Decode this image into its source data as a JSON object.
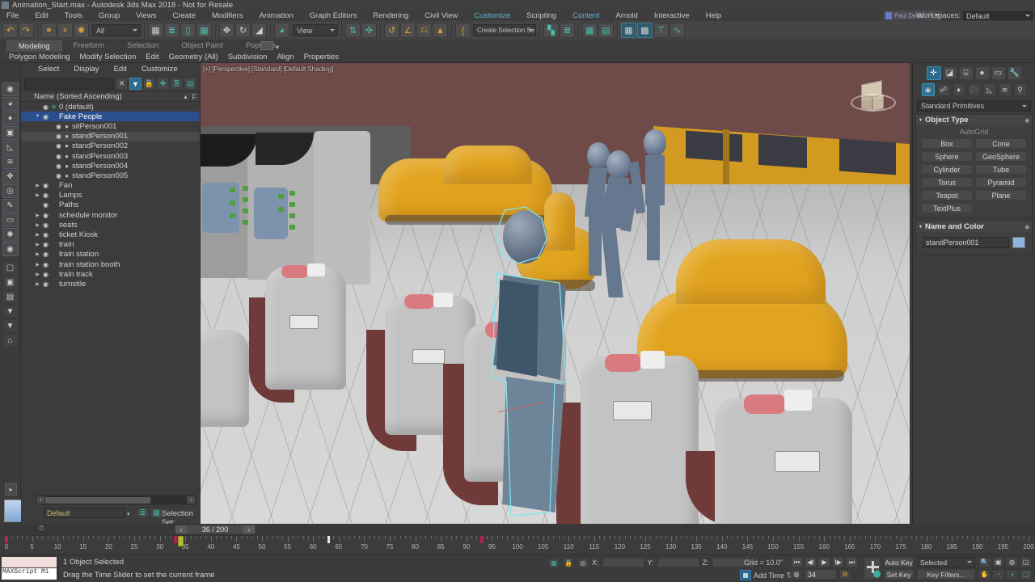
{
  "window": {
    "title": "Animation_Start.max - Autodesk 3ds Max 2018 - Not for Resale",
    "app_icon": "max-logo-icon"
  },
  "menu": {
    "items": [
      "File",
      "Edit",
      "Tools",
      "Group",
      "Views",
      "Create",
      "Modifiers",
      "Animation",
      "Graph Editors",
      "Rendering",
      "Civil View",
      "Customize",
      "Scripting",
      "Content",
      "Arnold",
      "Interactive",
      "Help"
    ]
  },
  "workspaces": {
    "label": "Workspaces:",
    "value": "Default"
  },
  "user": {
    "name": "Paul Dean"
  },
  "main_toolbar": {
    "selection_filter": "All",
    "reference_coord": "View",
    "named_selection_set": "Create Selection Se",
    "buttons": [
      {
        "name": "undo-button",
        "glyph": "↶"
      },
      {
        "name": "redo-button",
        "glyph": "↷"
      },
      {
        "name": "select-link-button",
        "glyph": "⛓"
      },
      {
        "name": "unlink-button",
        "glyph": "⛓"
      },
      {
        "name": "bind-space-warp-button",
        "glyph": "✳"
      },
      {
        "name": "select-object-button",
        "glyph": "▣"
      },
      {
        "name": "select-by-name-button",
        "glyph": "≣"
      },
      {
        "name": "rectangular-select-region-button",
        "glyph": "▭"
      },
      {
        "name": "window-crossing-button",
        "glyph": "▨"
      },
      {
        "name": "select-and-move-button",
        "glyph": "✥"
      },
      {
        "name": "select-and-rotate-button",
        "glyph": "↻"
      },
      {
        "name": "select-and-scale-button",
        "glyph": "◲"
      },
      {
        "name": "use-center-flyout-button",
        "glyph": "◕"
      },
      {
        "name": "mirror-button",
        "glyph": "⇹"
      },
      {
        "name": "align-button",
        "glyph": "⊹"
      },
      {
        "name": "layer-explorer-button",
        "glyph": "▤"
      },
      {
        "name": "curve-editor-button",
        "glyph": "〜"
      },
      {
        "name": "schematic-view-button",
        "glyph": "◔"
      },
      {
        "name": "percent-snap-button",
        "glyph": "%"
      },
      {
        "name": "angle-snap-button",
        "glyph": "∠"
      },
      {
        "name": "spinner-snap-button",
        "glyph": "⌁"
      },
      {
        "name": "material-editor-button",
        "glyph": "◍"
      },
      {
        "name": "render-setup-button",
        "glyph": "▤"
      },
      {
        "name": "render-frame-window-button",
        "glyph": "▦"
      },
      {
        "name": "render-production-button",
        "glyph": "▩"
      },
      {
        "name": "render-iterative-button",
        "glyph": "▨"
      },
      {
        "name": "active-shade-button",
        "glyph": "⊤"
      },
      {
        "name": "project-folder-button",
        "glyph": "⊷"
      }
    ]
  },
  "ribbon": {
    "tabs": [
      "Modeling",
      "Freeform",
      "Selection",
      "Object Paint",
      "Populate"
    ],
    "active_tab": "Modeling",
    "subtabs": [
      "Polygon Modeling",
      "Modify Selection",
      "Edit",
      "Geometry (All)",
      "Subdivision",
      "Align",
      "Properties"
    ]
  },
  "left_toolbar": {
    "buttons": [
      {
        "name": "select-object-tool",
        "glyph": "◉"
      },
      {
        "name": "select-similar-tool",
        "glyph": "◕"
      },
      {
        "name": "select-light-tool",
        "glyph": "♦"
      },
      {
        "name": "select-camera-tool",
        "glyph": "▣"
      },
      {
        "name": "select-helper-tool",
        "glyph": "◺"
      },
      {
        "name": "select-spline-tool",
        "glyph": "≋"
      },
      {
        "name": "select-shape-tool",
        "glyph": "✥"
      },
      {
        "name": "select-group-tool",
        "glyph": "◎"
      },
      {
        "name": "select-bone-tool",
        "glyph": "✎"
      },
      {
        "name": "select-box-tool",
        "glyph": "▭"
      },
      {
        "name": "select-particle-tool",
        "glyph": "✺"
      },
      {
        "name": "select-vis-tool",
        "glyph": "◉"
      },
      {
        "name": "layer-tool-1",
        "glyph": "▢"
      },
      {
        "name": "layer-tool-2",
        "glyph": "▣"
      },
      {
        "name": "layer-tool-3",
        "glyph": "▤"
      },
      {
        "name": "filter-tool-1",
        "glyph": "▼"
      },
      {
        "name": "filter-tool-2",
        "glyph": "▼"
      },
      {
        "name": "display-tool",
        "glyph": "⌂"
      }
    ]
  },
  "explorer": {
    "menu": [
      "Select",
      "Display",
      "Edit",
      "Customize"
    ],
    "search_value": "",
    "toolbar_buttons": [
      {
        "name": "clear-search-button",
        "glyph": "✕"
      },
      {
        "name": "filter-button",
        "glyph": "▼"
      },
      {
        "name": "lock-button",
        "glyph": "🔒"
      },
      {
        "name": "add-object-button",
        "glyph": "✛"
      },
      {
        "name": "layer-button",
        "glyph": "≋"
      },
      {
        "name": "new-layer-button",
        "glyph": "▤"
      }
    ],
    "column_header": "Name (Sorted Ascending)",
    "sort_glyph": "▲",
    "frozen_column": "F",
    "rows": [
      {
        "indent": 1,
        "arrow": "",
        "eye": "👁",
        "dot": "layer",
        "label": "0 (default)",
        "state": "normal"
      },
      {
        "indent": 1,
        "arrow": "▼",
        "eye": "👁",
        "dot": "",
        "label": "Fake People",
        "state": "selected"
      },
      {
        "indent": 2,
        "arrow": "",
        "eye": "👁",
        "dot": "●",
        "label": "sitPerson001",
        "state": "normal"
      },
      {
        "indent": 2,
        "arrow": "",
        "eye": "👁",
        "dot": "●",
        "label": "standPerson001",
        "state": "highlighted"
      },
      {
        "indent": 2,
        "arrow": "",
        "eye": "👁",
        "dot": "●",
        "label": "standPerson002",
        "state": "normal"
      },
      {
        "indent": 2,
        "arrow": "",
        "eye": "👁",
        "dot": "●",
        "label": "standPerson003",
        "state": "normal"
      },
      {
        "indent": 2,
        "arrow": "",
        "eye": "👁",
        "dot": "●",
        "label": "standPerson004",
        "state": "normal"
      },
      {
        "indent": 2,
        "arrow": "",
        "eye": "👁",
        "dot": "●",
        "label": "standPerson005",
        "state": "normal"
      },
      {
        "indent": 1,
        "arrow": "▶",
        "eye": "👁",
        "dot": "",
        "label": "Fan",
        "state": "normal"
      },
      {
        "indent": 1,
        "arrow": "▶",
        "eye": "👁",
        "dot": "",
        "label": "Lamps",
        "state": "normal"
      },
      {
        "indent": 1,
        "arrow": "",
        "eye": "👁",
        "dot": "",
        "label": "Paths",
        "state": "normal"
      },
      {
        "indent": 1,
        "arrow": "▶",
        "eye": "👁",
        "dot": "",
        "label": "schedule monitor",
        "state": "normal"
      },
      {
        "indent": 1,
        "arrow": "▶",
        "eye": "👁",
        "dot": "",
        "label": "seats",
        "state": "normal"
      },
      {
        "indent": 1,
        "arrow": "▶",
        "eye": "👁",
        "dot": "",
        "label": "ticket Kiosk",
        "state": "normal"
      },
      {
        "indent": 1,
        "arrow": "▶",
        "eye": "👁",
        "dot": "",
        "label": "train",
        "state": "normal"
      },
      {
        "indent": 1,
        "arrow": "▶",
        "eye": "👁",
        "dot": "",
        "label": "train station",
        "state": "normal"
      },
      {
        "indent": 1,
        "arrow": "▶",
        "eye": "👁",
        "dot": "",
        "label": "train station booth",
        "state": "normal"
      },
      {
        "indent": 1,
        "arrow": "▶",
        "eye": "👁",
        "dot": "",
        "label": "train track",
        "state": "normal"
      },
      {
        "indent": 1,
        "arrow": "▶",
        "eye": "👁",
        "dot": "",
        "label": "turnstile",
        "state": "normal"
      }
    ],
    "footer": {
      "layer_value": "Default",
      "selection_set_label": "Selection Set:",
      "scroll_left": "‹",
      "scroll_right": "›"
    }
  },
  "viewport": {
    "label": "[+] [Perspective] [Standard] [Default Shading]",
    "scene_description": "Train station platform with seats, yellow benches, ticket kiosks, train and stick figure people",
    "selected_object_outline_color": "#7fe8f5"
  },
  "command_panel": {
    "tabs": [
      {
        "name": "create-tab",
        "glyph": "✛",
        "active": true
      },
      {
        "name": "modify-tab",
        "glyph": "◪",
        "active": false
      },
      {
        "name": "hierarchy-tab",
        "glyph": "⌸",
        "active": false
      },
      {
        "name": "motion-tab",
        "glyph": "●",
        "active": false
      },
      {
        "name": "display-tab",
        "glyph": "▭",
        "active": false
      },
      {
        "name": "utilities-tab",
        "glyph": "🔧",
        "active": false
      }
    ],
    "create_icons": [
      {
        "name": "geometry-icon",
        "glyph": "◉",
        "active": true
      },
      {
        "name": "shapes-icon",
        "glyph": "☍",
        "active": false
      },
      {
        "name": "lights-icon",
        "glyph": "♦",
        "active": false
      },
      {
        "name": "cameras-icon",
        "glyph": "🎥",
        "active": false
      },
      {
        "name": "helpers-icon",
        "glyph": "◺",
        "active": false
      },
      {
        "name": "space-warps-icon",
        "glyph": "≋",
        "active": false
      },
      {
        "name": "systems-icon",
        "glyph": "⚲",
        "active": false
      }
    ],
    "category_value": "Standard Primitives",
    "object_type": {
      "title": "Object Type",
      "autogrid_label": "AutoGrid",
      "buttons": [
        "Box",
        "Cone",
        "Sphere",
        "GeoSphere",
        "Cylinder",
        "Tube",
        "Torus",
        "Pyramid",
        "Teapot",
        "Plane",
        "TextPlus"
      ]
    },
    "name_and_color": {
      "title": "Name and Color",
      "name_value": "standPerson001",
      "color": "#8eb4e0"
    }
  },
  "timeline": {
    "frame_display": "36 / 200",
    "prev_glyph": "‹",
    "next_glyph": "›",
    "range_start": 0,
    "range_end": 200,
    "tick_step": 5,
    "current_frame": 34,
    "slider_frame": 34,
    "key_frames": [
      0,
      33,
      93
    ],
    "white_marker_frame": 63,
    "tick_labels": [
      0,
      5,
      10,
      15,
      20,
      25,
      30,
      35,
      40,
      45,
      50,
      55,
      60,
      65,
      70,
      75,
      80,
      85,
      90,
      95,
      100,
      105,
      110,
      115,
      120,
      125,
      130,
      135,
      140,
      145,
      150,
      155,
      160,
      165,
      170,
      175,
      180,
      185,
      190,
      195,
      200
    ]
  },
  "status_bar": {
    "maxscript_label": "MAXScript Mi",
    "selection_status": "1 Object Selected",
    "prompt": "Drag the Time Slider to set the current frame",
    "coords": {
      "x_label": "X:",
      "x_value": "",
      "y_label": "Y:",
      "y_value": "",
      "z_label": "Z:",
      "z_value": ""
    },
    "grid_text": "Grid = 10.0\"",
    "add_time_tag": "Add Time Tag",
    "current_frame_field": "34",
    "auto_key": "Auto Key",
    "set_key": "Set Key",
    "key_mode_value": "Selected",
    "key_filters": "Key Filters...",
    "playback_buttons": [
      {
        "name": "goto-start-button",
        "glyph": "⏮"
      },
      {
        "name": "previous-frame-button",
        "glyph": "◀Ⅰ"
      },
      {
        "name": "play-animation-button",
        "glyph": "▶"
      },
      {
        "name": "next-frame-button",
        "glyph": "Ⅰ▶"
      },
      {
        "name": "goto-end-button",
        "glyph": "⏭"
      }
    ],
    "nav_buttons": [
      {
        "name": "zoom-button",
        "glyph": "🔍"
      },
      {
        "name": "zoom-all-button",
        "glyph": "▣"
      },
      {
        "name": "zoom-extents-button",
        "glyph": "◍"
      },
      {
        "name": "zoom-region-button",
        "glyph": "◲"
      },
      {
        "name": "pan-button",
        "glyph": "✋"
      },
      {
        "name": "orbit-button",
        "glyph": "◔"
      },
      {
        "name": "field-of-view-button",
        "glyph": "◑"
      },
      {
        "name": "maximize-viewport-button",
        "glyph": "▢"
      }
    ]
  }
}
